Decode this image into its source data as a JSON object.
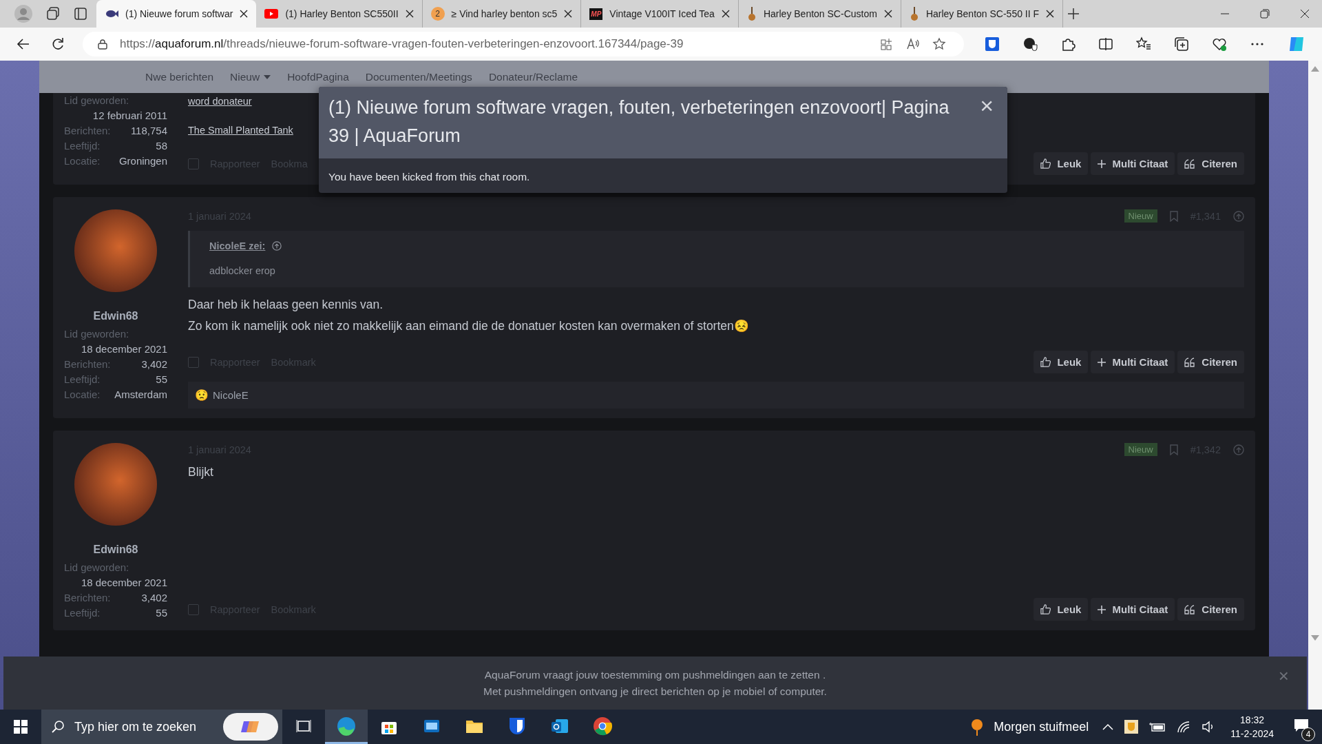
{
  "browser": {
    "tabs": [
      {
        "title": "(1) Nieuwe forum softwar",
        "selected": true,
        "kind": "fish"
      },
      {
        "title": "(1) Harley Benton SC550II",
        "selected": false,
        "kind": "video"
      },
      {
        "title": "≥ Vind harley benton sc5",
        "selected": false,
        "kind": "badge",
        "icon_text": "2"
      },
      {
        "title": "Vintage V100IT Iced Tea",
        "selected": false,
        "kind": "logo",
        "icon_text": "MP"
      },
      {
        "title": "Harley Benton SC-Custom",
        "selected": false,
        "kind": "guitar"
      },
      {
        "title": "Harley Benton SC-550 II F",
        "selected": false,
        "kind": "guitar"
      }
    ],
    "url": {
      "scheme": "https://",
      "domain": "aquaforum.nl",
      "path": "/threads/nieuwe-forum-software-vragen-fouten-verbeteringen-enzovoort.167344/page-39"
    }
  },
  "nav": {
    "items": [
      {
        "label": "Nwe berichten",
        "dropdown": false
      },
      {
        "label": "Nieuw",
        "dropdown": true
      },
      {
        "label": "HoofdPagina",
        "dropdown": false
      },
      {
        "label": "Documenten/Meetings",
        "dropdown": false
      },
      {
        "label": "Donateur/Reclame",
        "dropdown": false
      }
    ]
  },
  "posts": [
    {
      "stats": [
        {
          "kind": "stacked",
          "label": "Lid geworden:",
          "value": "12 februari 2011"
        },
        {
          "kind": "inline",
          "label": "Berichten:",
          "value": "118,754"
        },
        {
          "kind": "inline",
          "label": "Leeftijd:",
          "value": "58"
        },
        {
          "kind": "inline",
          "label": "Locatie:",
          "value": "Groningen"
        }
      ],
      "signature_links": [
        "word donateur",
        "The Small Planted Tank"
      ],
      "select": {
        "checked": false
      },
      "footer_links": [
        "Rapporteer",
        "Bookma"
      ],
      "actions": [
        "Leuk",
        "Multi Citaat",
        "Citeren"
      ]
    },
    {
      "username": "Edwin68",
      "stats": [
        {
          "kind": "stacked",
          "label": "Lid geworden:",
          "value": "18 december 2021"
        },
        {
          "kind": "inline",
          "label": "Berichten:",
          "value": "3,402"
        },
        {
          "kind": "inline",
          "label": "Leeftijd:",
          "value": "55"
        },
        {
          "kind": "inline",
          "label": "Locatie:",
          "value": "Amsterdam"
        }
      ],
      "date": "1 januari 2024",
      "badge": "Nieuw",
      "number": "#1,341",
      "quote": {
        "author": "NicoleE zei:",
        "text": "adblocker erop"
      },
      "body": [
        "Daar heb ik helaas geen kennis van.",
        "Zo kom ik namelijk ook niet zo makkelijk aan eimand die de donatuer kosten kan overmaken of storten😣"
      ],
      "select": {
        "checked": false
      },
      "footer_links": [
        "Rapporteer",
        "Bookmark"
      ],
      "actions": [
        "Leuk",
        "Multi Citaat",
        "Citeren"
      ],
      "reactions": {
        "emoji": "😟",
        "users": "NicoleE"
      }
    },
    {
      "username": "Edwin68",
      "stats": [
        {
          "kind": "stacked",
          "label": "Lid geworden:",
          "value": "18 december 2021"
        },
        {
          "kind": "inline",
          "label": "Berichten:",
          "value": "3,402"
        },
        {
          "kind": "inline",
          "label": "Leeftijd:",
          "value": "55"
        }
      ],
      "date": "1 januari 2024",
      "badge": "Nieuw",
      "number": "#1,342",
      "body": [
        "Blijkt"
      ],
      "select": {
        "checked": false
      },
      "footer_links": [
        "Rapporteer",
        "Bookmark"
      ],
      "actions": [
        "Leuk",
        "Multi Citaat",
        "Citeren"
      ]
    }
  ],
  "dialog": {
    "title": "(1) Nieuwe forum software vragen, fouten, verbeteringen enzovoort| Pagina 39 | AquaForum",
    "close": "×",
    "message": "You have been kicked from this chat room."
  },
  "push_notice": {
    "lines": [
      "AquaForum vraagt jouw toestemming om pushmeldingen aan te zetten .",
      "Met pushmeldingen ontvang je direct berichten op je mobiel of computer."
    ],
    "close": "×"
  },
  "taskbar": {
    "search_placeholder": "Typ hier om te zoeken",
    "apps": [
      {
        "kind": "taskview",
        "active": false
      },
      {
        "kind": "edge",
        "active": true
      },
      {
        "kind": "store",
        "active": false
      },
      {
        "kind": "mail",
        "active": false
      },
      {
        "kind": "folder",
        "active": false
      },
      {
        "kind": "shield",
        "active": false
      },
      {
        "kind": "outlook",
        "active": false
      },
      {
        "kind": "chrome",
        "active": false
      }
    ],
    "weather": "Morgen stuifmeel",
    "time": "18:32",
    "date": "11-2-2024",
    "notifications": "4"
  }
}
